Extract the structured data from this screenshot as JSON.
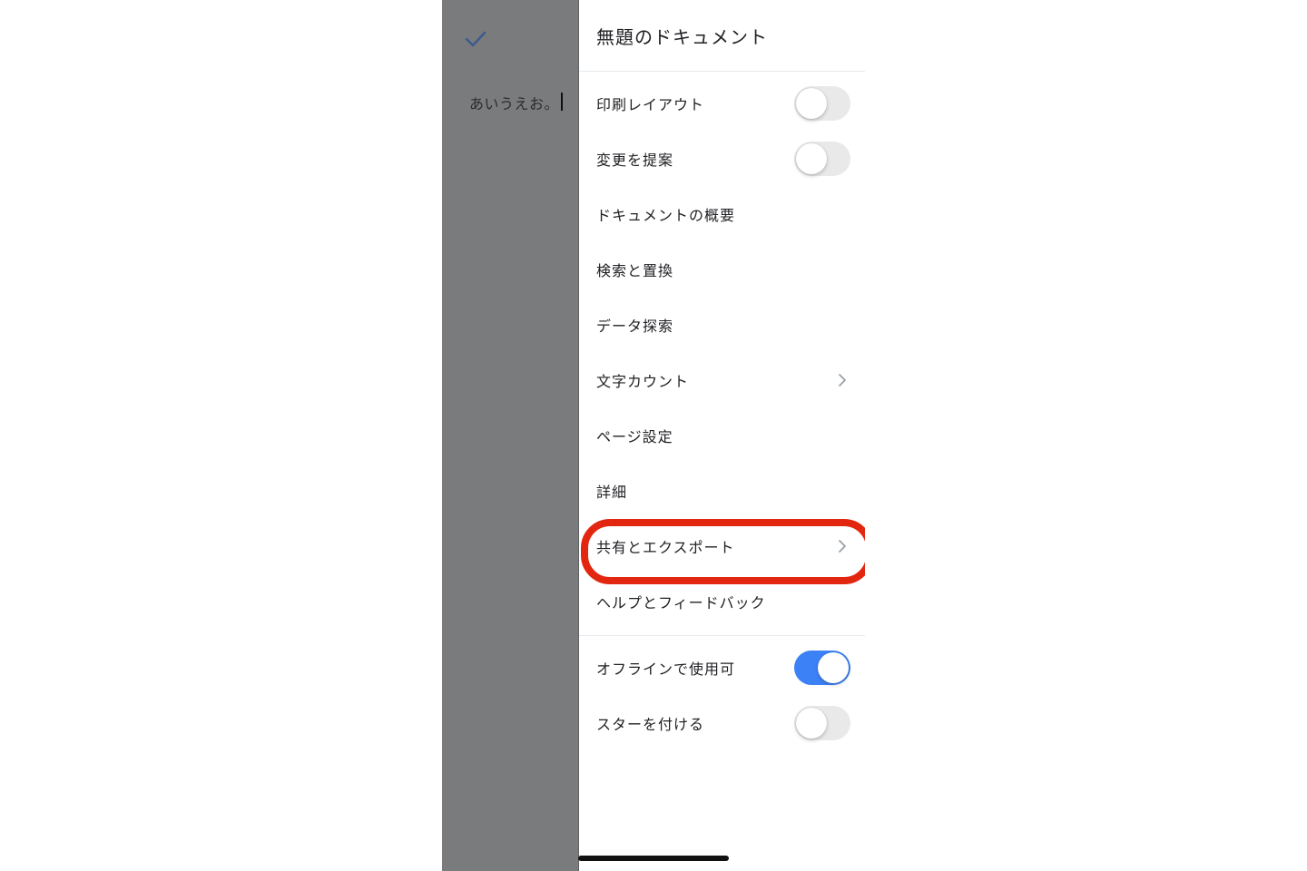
{
  "document": {
    "body_text": "あいうえお。"
  },
  "menu": {
    "title": "無題のドキュメント",
    "items": [
      {
        "label": "印刷レイアウト",
        "control": "toggle",
        "on": false
      },
      {
        "label": "変更を提案",
        "control": "toggle",
        "on": false
      },
      {
        "label": "ドキュメントの概要"
      },
      {
        "label": "検索と置換"
      },
      {
        "label": "データ探索"
      },
      {
        "label": "文字カウント",
        "control": "chevron"
      },
      {
        "label": "ページ設定"
      },
      {
        "label": "詳細"
      },
      {
        "label": "共有とエクスポート",
        "control": "chevron",
        "highlighted": true
      },
      {
        "label": "ヘルプとフィードバック"
      },
      {
        "label": "オフラインで使用可",
        "control": "toggle",
        "on": true
      },
      {
        "label": "スターを付ける",
        "control": "toggle",
        "on": false
      }
    ]
  },
  "colors": {
    "toggle_on": "#3c82f6",
    "highlight": "#e3260f",
    "check_icon": "#3b5a8c"
  }
}
